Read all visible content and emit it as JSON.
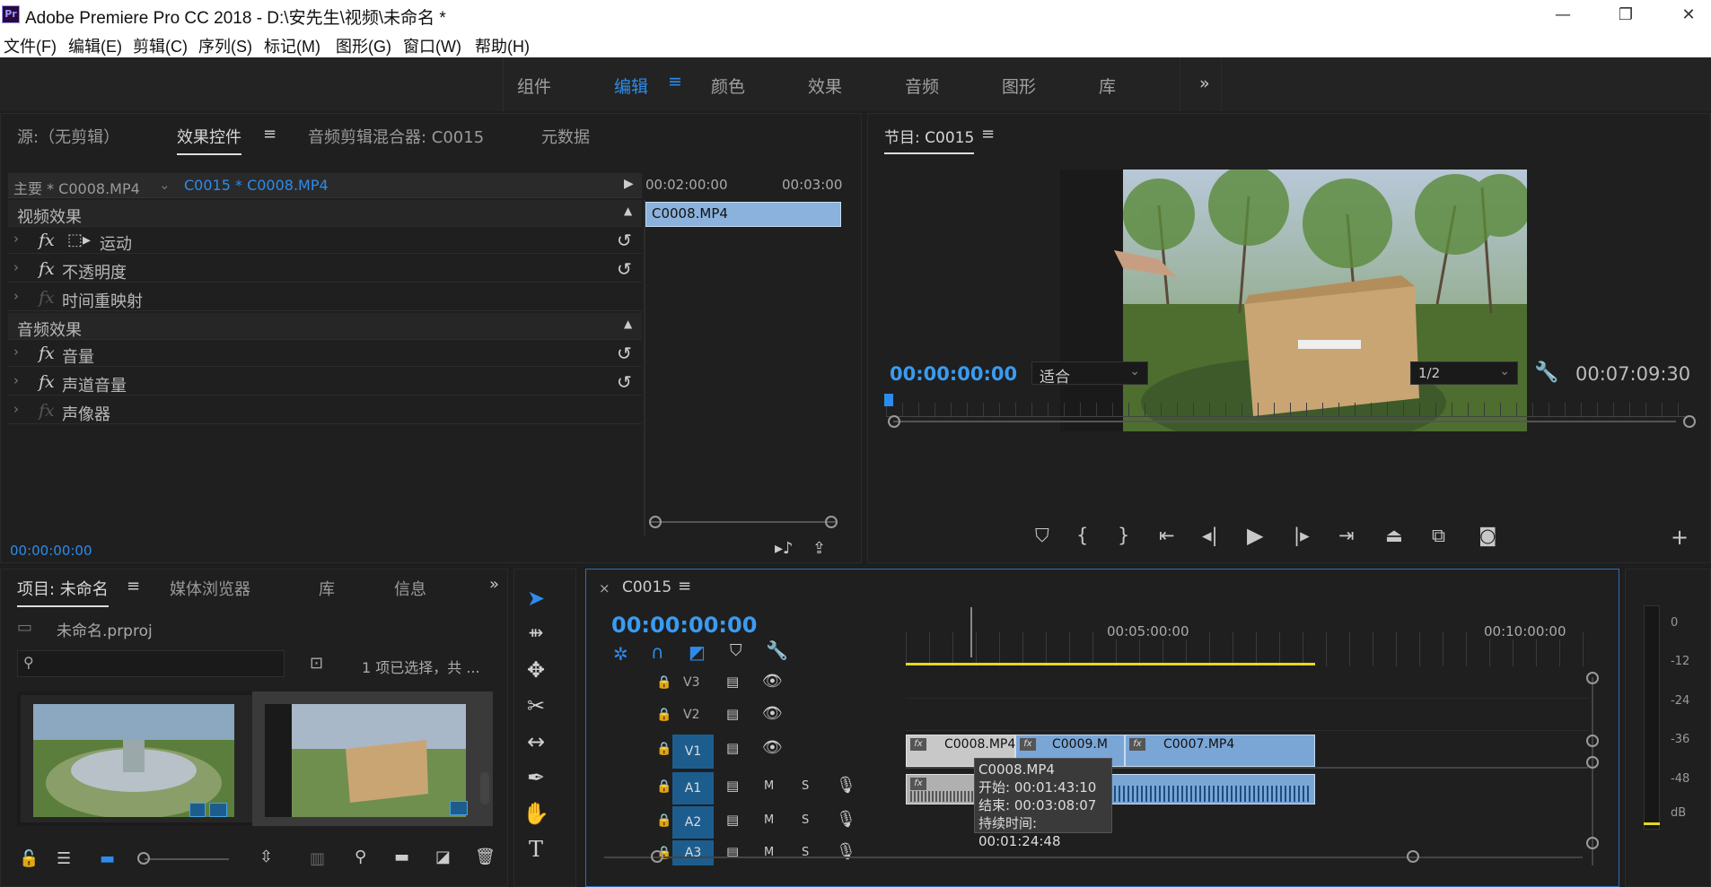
{
  "window": {
    "title": "Adobe Premiere Pro CC 2018 - D:\\安先生\\视频\\未命名 *",
    "app_icon": "Pr"
  },
  "menu": [
    "文件(F)",
    "编辑(E)",
    "剪辑(C)",
    "序列(S)",
    "标记(M)",
    "图形(G)",
    "窗口(W)",
    "帮助(H)"
  ],
  "workspaces": [
    "组件",
    "编辑",
    "颜色",
    "效果",
    "音频",
    "图形",
    "库"
  ],
  "workspace_active": "编辑",
  "effect_panel": {
    "tabs": [
      "源:（无剪辑）",
      "效果控件",
      "音频剪辑混合器: C0015",
      "元数据"
    ],
    "master_label": "主要 * C0008.MP4",
    "sequence_label": "C0015 * C0008.MP4",
    "ruler": [
      "00:02:00:00",
      "00:03:00"
    ],
    "clip": "C0008.MP4",
    "video_header": "视频效果",
    "audio_header": "音频效果",
    "video_effects": [
      "运动",
      "不透明度",
      "时间重映射"
    ],
    "audio_effects": [
      "音量",
      "声道音量",
      "声像器"
    ],
    "timecode": "00:00:00:00"
  },
  "program_monitor": {
    "title": "节目: C0015",
    "timecode": "00:00:00:00",
    "fit": "适合",
    "resolution": "1/2",
    "duration": "00:07:09:30"
  },
  "project_panel": {
    "tabs": [
      "项目: 未命名",
      "媒体浏览器",
      "库",
      "信息"
    ],
    "file": "未命名.prproj",
    "selection": "1 项已选择，共 ..."
  },
  "timeline": {
    "title": "C0015",
    "timecode": "00:00:00:00",
    "ruler": [
      "00:05:00:00",
      "00:10:00:00"
    ],
    "video_tracks": [
      "V3",
      "V2",
      "V1"
    ],
    "audio_tracks": [
      "A1",
      "A2",
      "A3"
    ],
    "track_buttons": {
      "mute": "M",
      "solo": "S"
    },
    "clips": [
      "C0008.MP4",
      "C0009.M",
      "C0007.MP4"
    ],
    "tooltip": {
      "name": "C0008.MP4",
      "start": "开始: 00:01:43:10",
      "end": "结束: 00:03:08:07",
      "duration": "持续时间: 00:01:24:48"
    }
  },
  "meter": {
    "labels": [
      "0",
      "-12",
      "-24",
      "-36",
      "-48",
      "dB"
    ]
  },
  "colors": {
    "accent": "#2d8ceb",
    "timecode": "#3a9bf0",
    "clip": "#7aa6d6"
  }
}
